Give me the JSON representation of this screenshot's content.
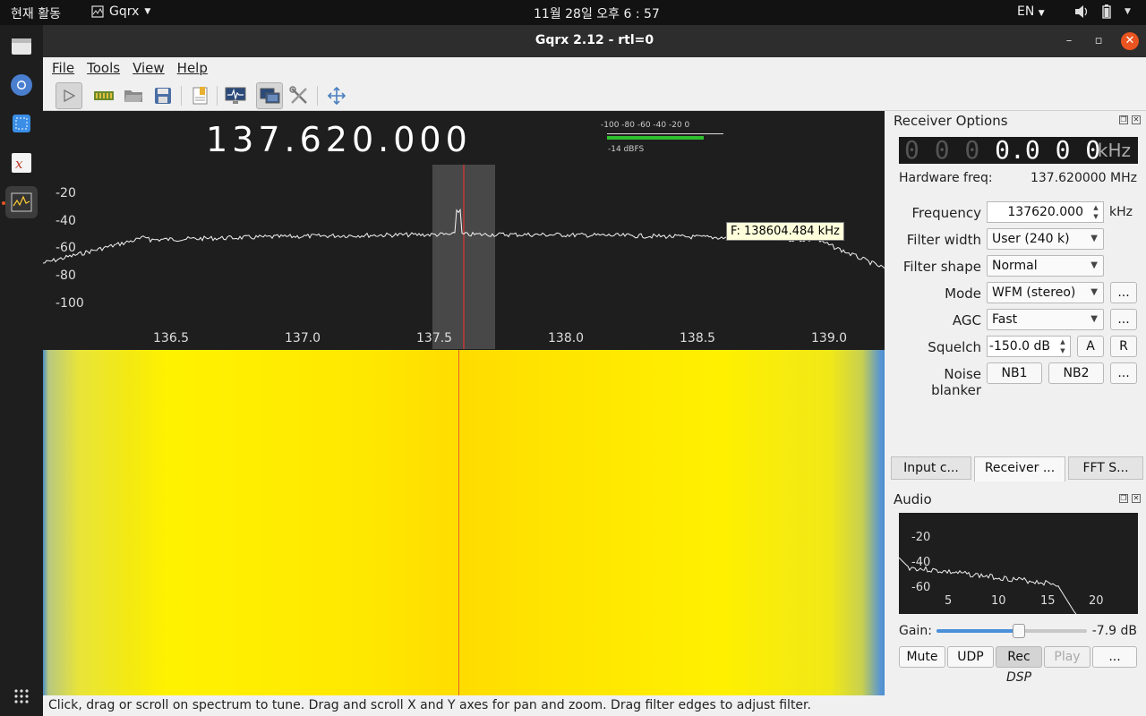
{
  "topbar": {
    "activities": "현재 활동",
    "app_name": "Gqrx",
    "clock": "11월 28일 오후 6 : 57",
    "language": "EN"
  },
  "window": {
    "title": "Gqrx 2.12 - rtl=0"
  },
  "menu": {
    "file": "File",
    "tools": "Tools",
    "view": "View",
    "help": "Help"
  },
  "display": {
    "frequency": "137.620.000",
    "smeter_scale": "-100  -80  -60  -40  -20   0",
    "smeter_readout": "-14 dBFS",
    "smeter_level": 0.83,
    "y_ticks": [
      "-20",
      "-40",
      "-60",
      "-80",
      "-100"
    ],
    "x_ticks": [
      "136.5",
      "137.0",
      "137.5",
      "138.0",
      "138.5",
      "139.0"
    ],
    "tooltip": "F: 138604.484 kHz"
  },
  "status": "Click, drag or scroll on spectrum to tune. Drag and scroll X and Y axes for pan and zoom. Drag filter edges to adjust filter.",
  "receiver": {
    "title": "Receiver Options",
    "lcd_dim": "0 0 0",
    "lcd_bright": "0.0 0 0",
    "lcd_unit": "kHz",
    "hw_freq_label": "Hardware freq:",
    "hw_freq_value": "137.620000 MHz",
    "frequency_label": "Frequency",
    "frequency_value": "137620.000",
    "frequency_unit": "kHz",
    "filter_width_label": "Filter width",
    "filter_width_value": "User (240 k)",
    "filter_shape_label": "Filter shape",
    "filter_shape_value": "Normal",
    "mode_label": "Mode",
    "mode_value": "WFM (stereo)",
    "agc_label": "AGC",
    "agc_value": "Fast",
    "squelch_label": "Squelch",
    "squelch_value": "-150.0 dB",
    "squelch_a": "A",
    "squelch_r": "R",
    "noise_blanker_label": "Noise blanker",
    "nb1": "NB1",
    "nb2": "NB2",
    "more": "..."
  },
  "tabs": [
    "Input c...",
    "Receiver ...",
    "FFT S..."
  ],
  "audio": {
    "title": "Audio",
    "y_ticks": [
      "-20",
      "-40",
      "-60"
    ],
    "x_ticks": [
      "5",
      "10",
      "15",
      "20"
    ],
    "gain_label": "Gain:",
    "gain_value": "-7.9 dB",
    "gain_level": 0.55,
    "mute": "Mute",
    "udp": "UDP",
    "rec": "Rec",
    "play": "Play",
    "more": "...",
    "dsp": "DSP"
  },
  "colors": {
    "accent": "#e95420",
    "smeter_bar": "#2fbf2f",
    "waterfall_main": "#fff200"
  }
}
